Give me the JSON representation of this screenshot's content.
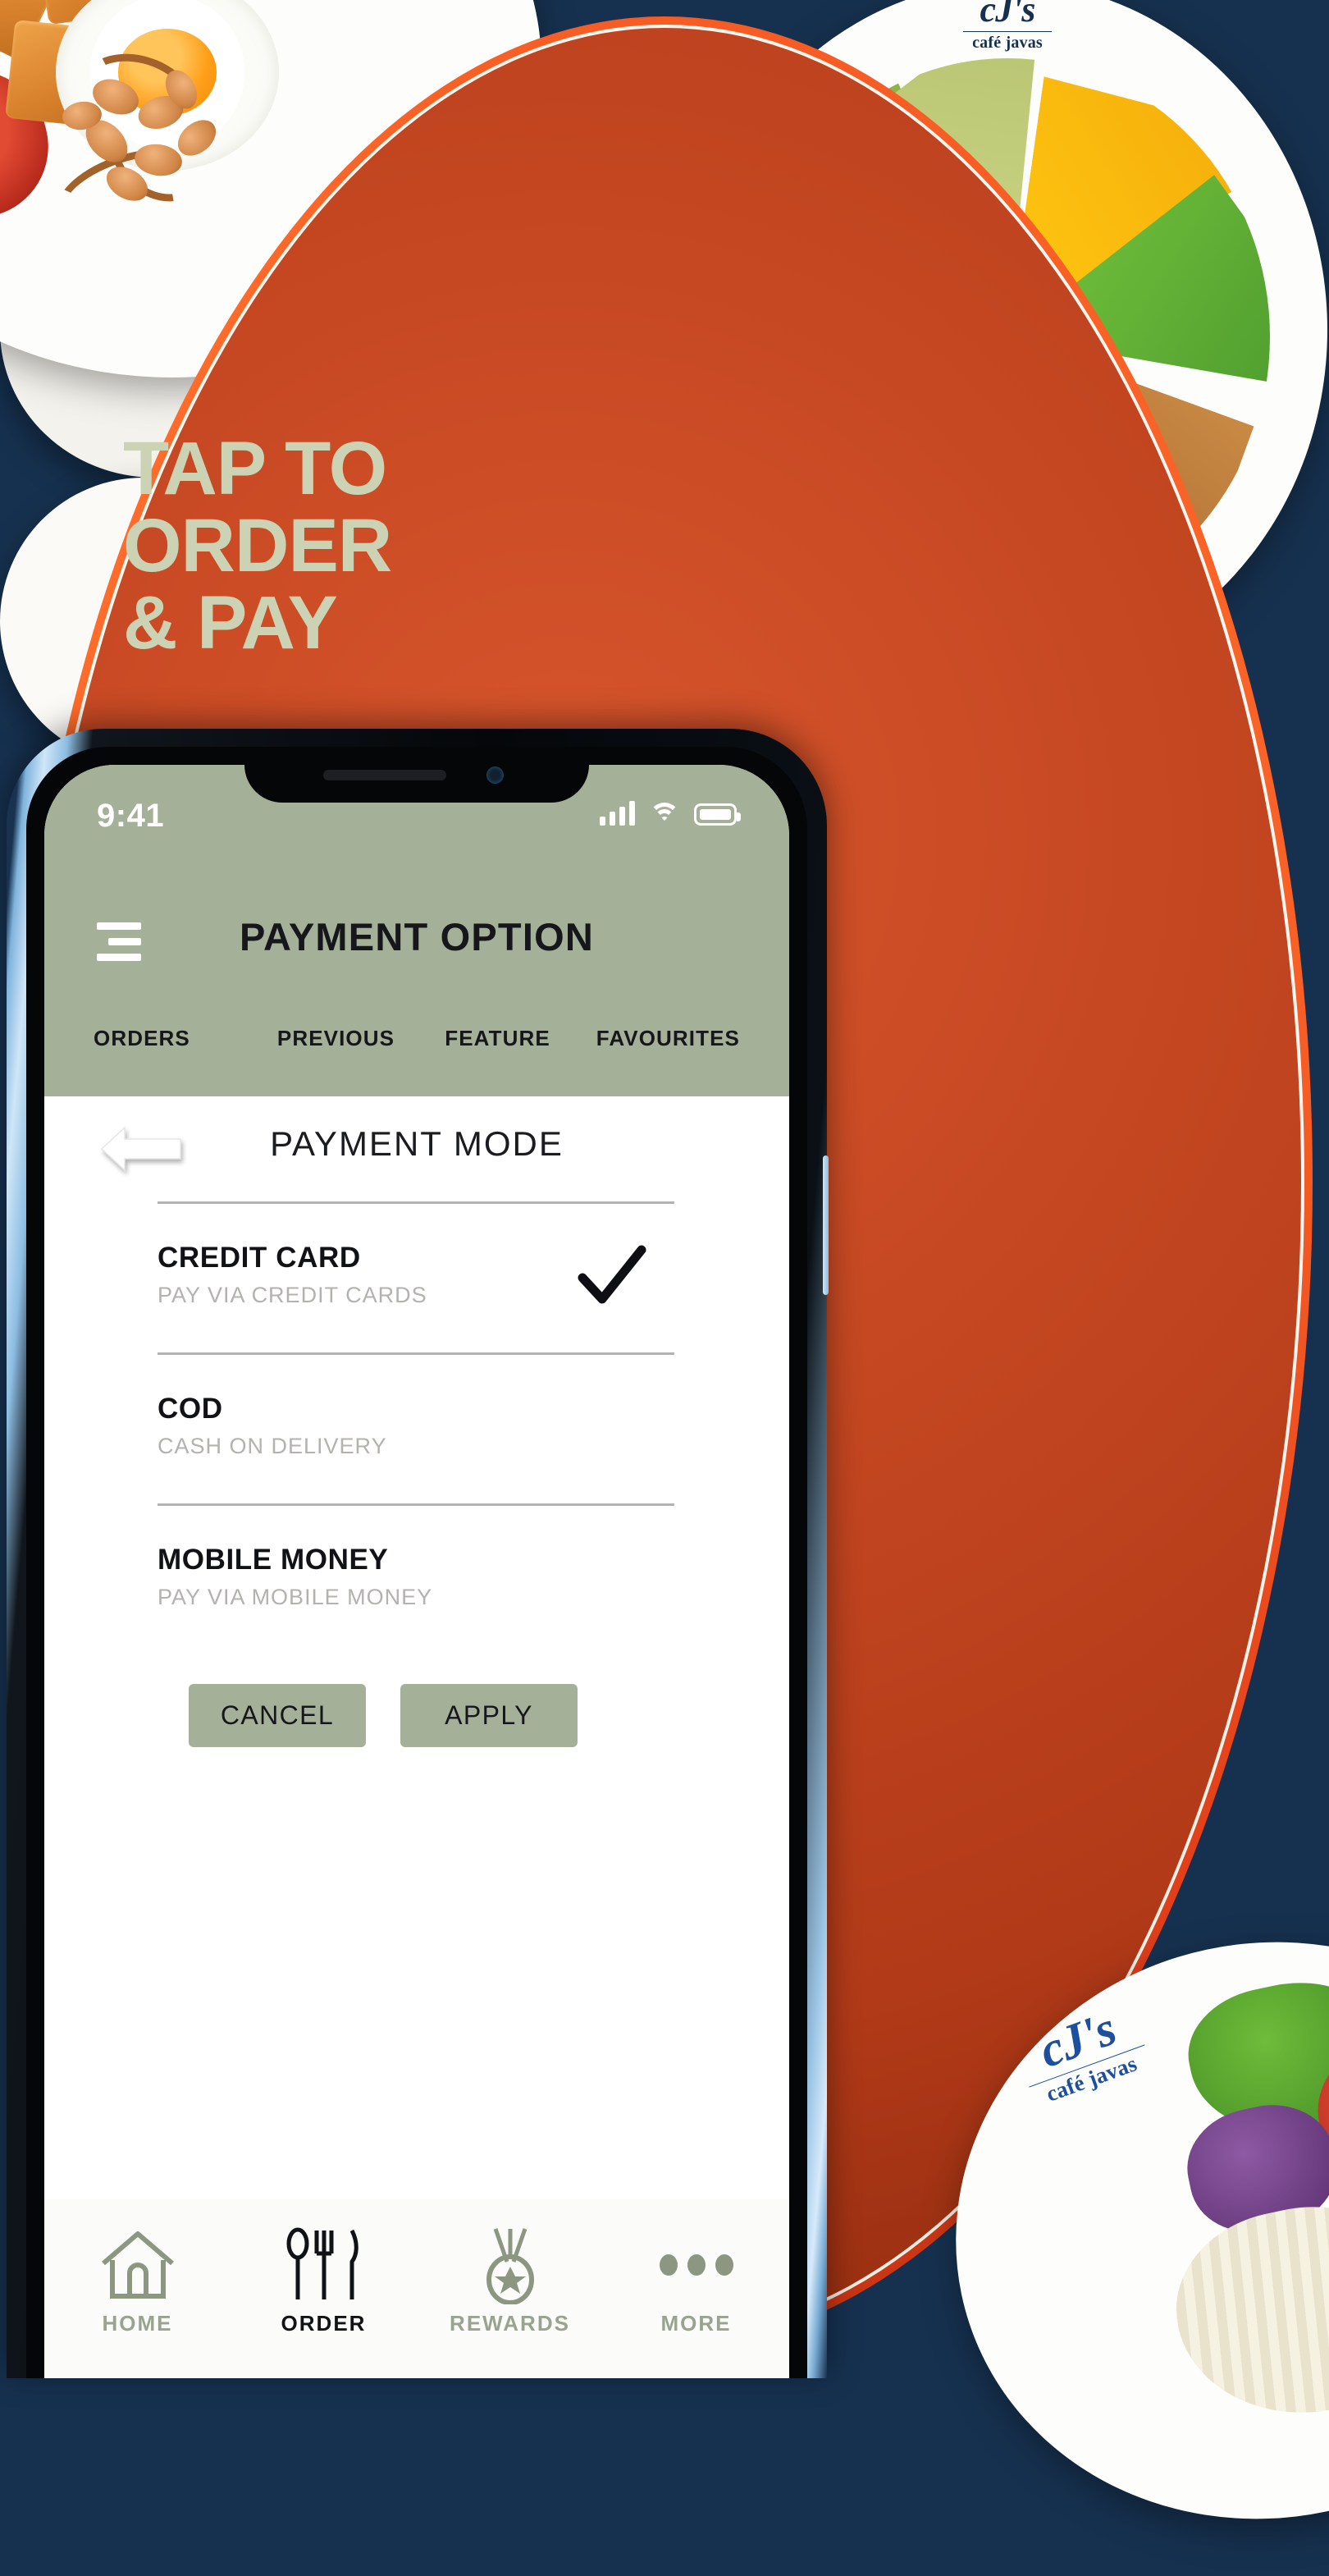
{
  "poster": {
    "background_color": "#16314f",
    "headline_color": "#ccd3b4",
    "headline_lines": [
      "TAP TO",
      "ORDER",
      "& PAY"
    ],
    "brand": {
      "mark": "cJ's",
      "sub": "café javas"
    }
  },
  "phone": {
    "status_bar": {
      "time": "9:41",
      "icons": [
        "signal-bars-icon",
        "wifi-icon",
        "battery-icon"
      ]
    },
    "header": {
      "menu_icon": "hamburger-menu-icon",
      "title": "PAYMENT OPTION",
      "accent_color": "#a5b099"
    },
    "tabs": [
      {
        "label": "ORDERS"
      },
      {
        "label": "PREVIOUS"
      },
      {
        "label": "FEATURE"
      },
      {
        "label": "FAVOURITES"
      }
    ],
    "content": {
      "back_icon": "back-arrow-icon",
      "section_title": "PAYMENT MODE",
      "payment_modes": [
        {
          "name": "CREDIT CARD",
          "desc": "PAY VIA CREDIT CARDS",
          "selected": true
        },
        {
          "name": "COD",
          "desc": "CASH ON DELIVERY",
          "selected": false
        },
        {
          "name": "MOBILE MONEY",
          "desc": "PAY VIA MOBILE MONEY",
          "selected": false
        }
      ],
      "buttons": {
        "cancel_label": "CANCEL",
        "apply_label": "APPLY"
      }
    },
    "bottom_nav": [
      {
        "label": "HOME",
        "icon": "home-icon",
        "active": false
      },
      {
        "label": "ORDER",
        "icon": "cutlery-icon",
        "active": true
      },
      {
        "label": "REWARDS",
        "icon": "medal-icon",
        "active": false
      },
      {
        "label": "MORE",
        "icon": "ellipsis-icon",
        "active": false
      }
    ]
  }
}
